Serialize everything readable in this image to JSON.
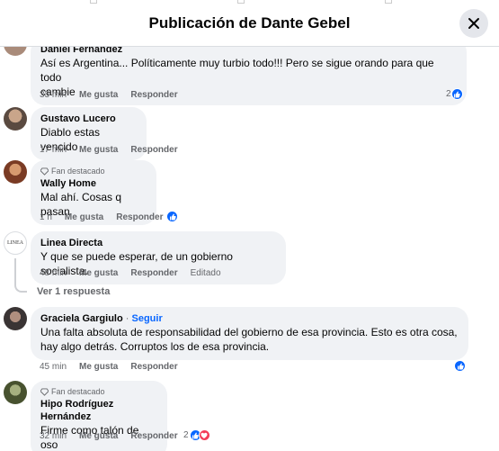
{
  "header": {
    "title": "Publicación de Dante Gebel"
  },
  "comments": [
    {
      "author": "Daniel Fernandez",
      "text_l1": "Así es Argentina... Políticamente muy turbio todo!!! Pero se sigue orando para que todo",
      "text_l2": "cambie",
      "time": "33 min",
      "like": "Me gusta",
      "reply": "Responder",
      "reactions": "2"
    },
    {
      "author": "Gustavo Lucero",
      "text": "Diablo estas vencido",
      "time": "17 min",
      "like": "Me gusta",
      "reply": "Responder"
    },
    {
      "badge": "Fan destacado",
      "author": "Wally Home",
      "text": "Mal ahí. Cosas q pasan",
      "time": "1 h",
      "like": "Me gusta",
      "reply": "Responder"
    },
    {
      "avatar_text": "LINEA",
      "author": "Linea Directa",
      "text": "Y que se puede esperar, de un gobierno socialista.",
      "time": "48 min",
      "like": "Me gusta",
      "reply": "Responder",
      "edited": "Editado",
      "view_replies": "Ver 1 respuesta"
    },
    {
      "author": "Graciela Gargiulo",
      "follow_sep": "·",
      "follow": "Seguir",
      "text_l1": "Una falta absoluta de responsabilidad del gobierno de esa provincia. Esto es otra cosa,",
      "text_l2": "hay algo detrás. Corruptos los de esa provincia.",
      "time": "45 min",
      "like": "Me gusta",
      "reply": "Responder"
    },
    {
      "badge": "Fan destacado",
      "author": "Hipo Rodríguez Hernández",
      "text": "Firme como talón de oso",
      "time": "32 min",
      "like": "Me gusta",
      "reply": "Responder",
      "reactions": "2"
    }
  ],
  "colors": {
    "accent": "#0866ff",
    "bubble": "#f0f2f5",
    "muted": "#65676b",
    "love": "#f33e58"
  },
  "icons": [
    "close-icon",
    "like-icon",
    "love-icon",
    "diamond-icon"
  ]
}
